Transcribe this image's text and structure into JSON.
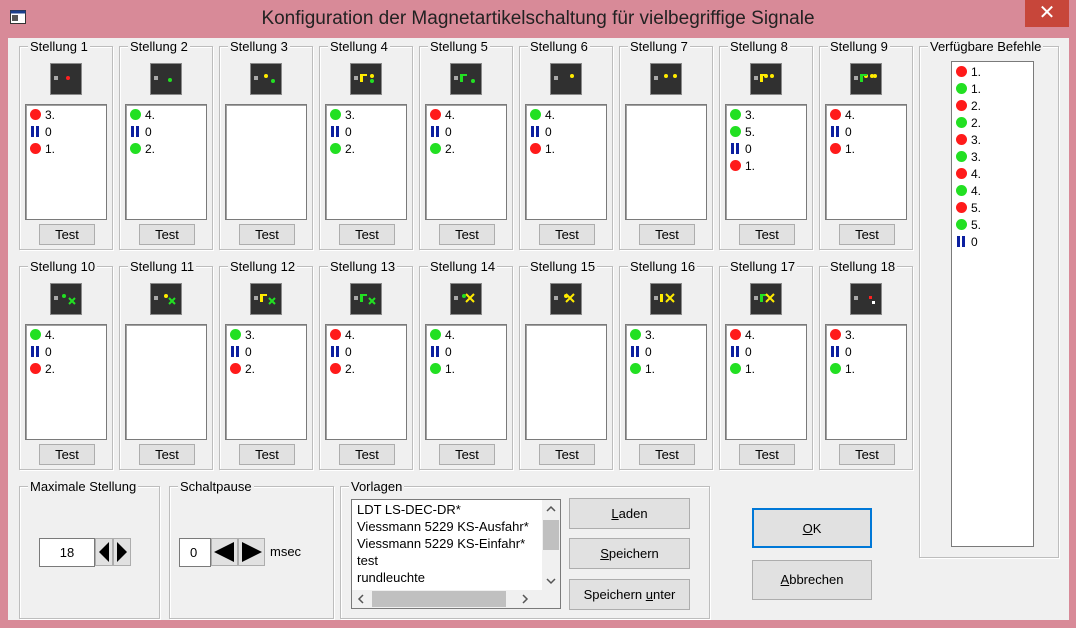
{
  "window": {
    "title": "Konfiguration der Magnetartikelschaltung für vielbegriffige Signale",
    "close_glyph": "✕"
  },
  "test_label": "Test",
  "positions": [
    {
      "label": "Stellung 1",
      "commands": [
        {
          "type": "red",
          "text": "3."
        },
        {
          "type": "pause",
          "text": "0"
        },
        {
          "type": "red",
          "text": "1."
        }
      ]
    },
    {
      "label": "Stellung 2",
      "commands": [
        {
          "type": "green",
          "text": "4."
        },
        {
          "type": "pause",
          "text": "0"
        },
        {
          "type": "green",
          "text": "2."
        }
      ]
    },
    {
      "label": "Stellung 3",
      "commands": []
    },
    {
      "label": "Stellung 4",
      "commands": [
        {
          "type": "green",
          "text": "3."
        },
        {
          "type": "pause",
          "text": "0"
        },
        {
          "type": "green",
          "text": "2."
        }
      ]
    },
    {
      "label": "Stellung 5",
      "commands": [
        {
          "type": "red",
          "text": "4."
        },
        {
          "type": "pause",
          "text": "0"
        },
        {
          "type": "green",
          "text": "2."
        }
      ]
    },
    {
      "label": "Stellung 6",
      "commands": [
        {
          "type": "green",
          "text": "4."
        },
        {
          "type": "pause",
          "text": "0"
        },
        {
          "type": "red",
          "text": "1."
        }
      ]
    },
    {
      "label": "Stellung 7",
      "commands": []
    },
    {
      "label": "Stellung 8",
      "commands": [
        {
          "type": "green",
          "text": "3."
        },
        {
          "type": "green",
          "text": "5."
        },
        {
          "type": "pause",
          "text": "0"
        },
        {
          "type": "red",
          "text": "1."
        }
      ]
    },
    {
      "label": "Stellung 9",
      "commands": [
        {
          "type": "red",
          "text": "4."
        },
        {
          "type": "pause",
          "text": "0"
        },
        {
          "type": "red",
          "text": "1."
        }
      ]
    },
    {
      "label": "Stellung 10",
      "commands": [
        {
          "type": "green",
          "text": "4."
        },
        {
          "type": "pause",
          "text": "0"
        },
        {
          "type": "red",
          "text": "2."
        }
      ]
    },
    {
      "label": "Stellung 11",
      "commands": []
    },
    {
      "label": "Stellung 12",
      "commands": [
        {
          "type": "green",
          "text": "3."
        },
        {
          "type": "pause",
          "text": "0"
        },
        {
          "type": "red",
          "text": "2."
        }
      ]
    },
    {
      "label": "Stellung 13",
      "commands": [
        {
          "type": "red",
          "text": "4."
        },
        {
          "type": "pause",
          "text": "0"
        },
        {
          "type": "red",
          "text": "2."
        }
      ]
    },
    {
      "label": "Stellung 14",
      "commands": [
        {
          "type": "green",
          "text": "4."
        },
        {
          "type": "pause",
          "text": "0"
        },
        {
          "type": "green",
          "text": "1."
        }
      ]
    },
    {
      "label": "Stellung 15",
      "commands": []
    },
    {
      "label": "Stellung 16",
      "commands": [
        {
          "type": "green",
          "text": "3."
        },
        {
          "type": "pause",
          "text": "0"
        },
        {
          "type": "green",
          "text": "1."
        }
      ]
    },
    {
      "label": "Stellung 17",
      "commands": [
        {
          "type": "red",
          "text": "4."
        },
        {
          "type": "pause",
          "text": "0"
        },
        {
          "type": "green",
          "text": "1."
        }
      ]
    },
    {
      "label": "Stellung 18",
      "commands": [
        {
          "type": "red",
          "text": "3."
        },
        {
          "type": "pause",
          "text": "0"
        },
        {
          "type": "green",
          "text": "1."
        }
      ]
    }
  ],
  "available": {
    "label": "Verfügbare Befehle",
    "commands": [
      {
        "type": "red",
        "text": "1."
      },
      {
        "type": "green",
        "text": "1."
      },
      {
        "type": "red",
        "text": "2."
      },
      {
        "type": "green",
        "text": "2."
      },
      {
        "type": "red",
        "text": "3."
      },
      {
        "type": "green",
        "text": "3."
      },
      {
        "type": "red",
        "text": "4."
      },
      {
        "type": "green",
        "text": "4."
      },
      {
        "type": "red",
        "text": "5."
      },
      {
        "type": "green",
        "text": "5."
      },
      {
        "type": "pause",
        "text": "0"
      }
    ]
  },
  "max_position": {
    "label": "Maximale Stellung",
    "value": "18"
  },
  "switch_pause": {
    "label": "Schaltpause",
    "value": "0",
    "unit": "msec"
  },
  "templates": {
    "label": "Vorlagen",
    "items": [
      "LDT LS-DEC-DR*",
      "Viessmann 5229 KS-Ausfahr*",
      "Viessmann 5229 KS-Einfahr*",
      "test",
      "rundleuchte"
    ],
    "selected": "LDT LS-DEC-DR*",
    "load": {
      "prefix": "",
      "mnemonic": "L",
      "suffix": "aden"
    },
    "save": {
      "prefix": "",
      "mnemonic": "S",
      "suffix": "peichern"
    },
    "save_as": {
      "prefix": "Speichern ",
      "mnemonic": "u",
      "suffix": "nter"
    }
  },
  "ok": {
    "prefix": "",
    "mnemonic": "O",
    "suffix": "K"
  },
  "cancel": {
    "prefix": "",
    "mnemonic": "A",
    "suffix": "bbrechen"
  },
  "colors": {
    "cmd_red": "#ff1a1a",
    "cmd_green": "#22e022",
    "pause_blue": "#0b1fa0",
    "selection": "#0078d7"
  }
}
